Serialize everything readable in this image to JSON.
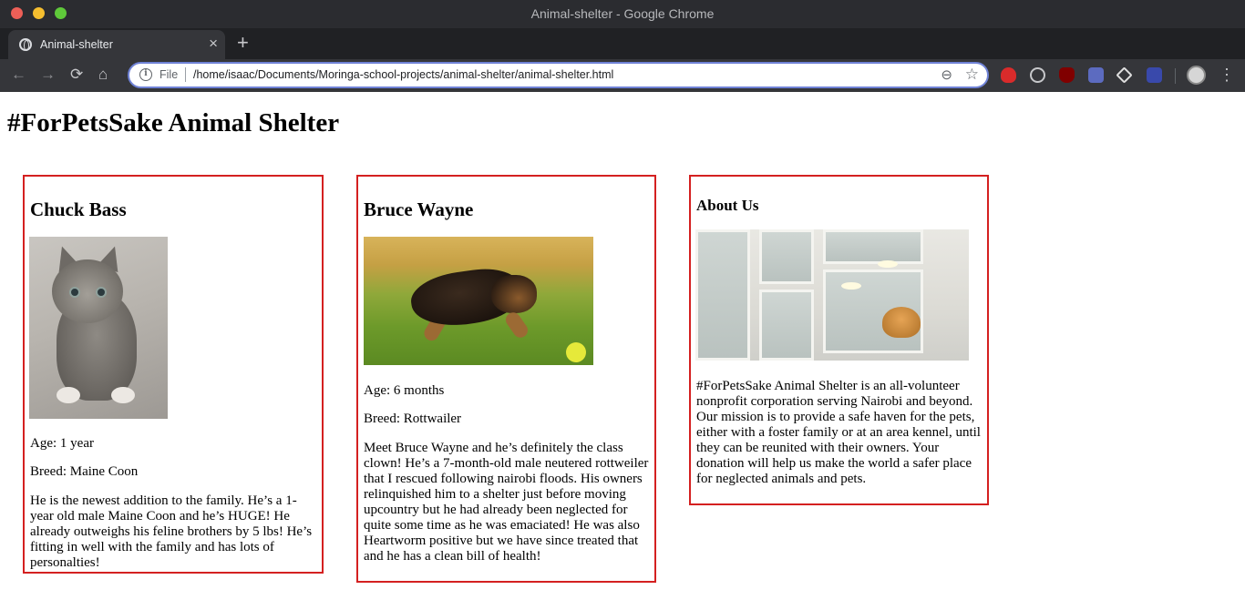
{
  "window": {
    "title": "Animal-shelter - Google Chrome"
  },
  "tab": {
    "title": "Animal-shelter",
    "close_glyph": "×",
    "new_tab_glyph": "+"
  },
  "toolbar": {
    "back_glyph": "←",
    "forward_glyph": "→",
    "reload_glyph": "⟳",
    "home_glyph": "⌂",
    "menu_glyph": "⋮",
    "info_glyph": "i",
    "zoom_glyph": "⊖",
    "star_glyph": "☆"
  },
  "address_bar": {
    "scheme": "File",
    "url": "/home/isaac/Documents/Moringa-school-projects/animal-shelter/animal-shelter.html"
  },
  "extensions": [
    "hand-icon",
    "globe-icon",
    "ublock-icon",
    "translate-icon",
    "diamond-icon",
    "book-icon"
  ],
  "page": {
    "title": "#ForPetsSake Animal Shelter"
  },
  "pets": [
    {
      "name": "Chuck Bass",
      "age": "Age: 1 year",
      "breed": "Breed: Maine Coon",
      "description": "He is the newest addition to the family. He’s a 1-year old male Maine Coon and he’s HUGE! He already outweighs his feline brothers by 5 lbs! He’s fitting in well with the family and has lots of personalties!"
    },
    {
      "name": "Bruce Wayne",
      "age": "Age: 6 months",
      "breed": "Breed: Rottwailer",
      "description": "Meet Bruce Wayne and he’s definitely the class clown! He’s a 7-month-old male neutered rottweiler that I rescued following nairobi floods. His owners relinquished him to a shelter just before moving upcountry but he had already been neglected for quite some time as he was emaciated! He was also Heartworm positive but we have since treated that and he has a clean bill of health!"
    }
  ],
  "about": {
    "heading": "About Us",
    "text": "#ForPetsSake Animal Shelter is an all-volunteer nonprofit corporation serving Nairobi and beyond. Our mission is to provide a safe haven for the pets, either with a foster family or at an area kennel, until they can be reunited with their owners. Your donation will help us make the world a safer place for neglected animals and pets."
  },
  "colors": {
    "card_border": "#d42020",
    "chrome_dark": "#202124",
    "toolbar": "#35363a",
    "omnibox_focus": "#6f82d6"
  }
}
